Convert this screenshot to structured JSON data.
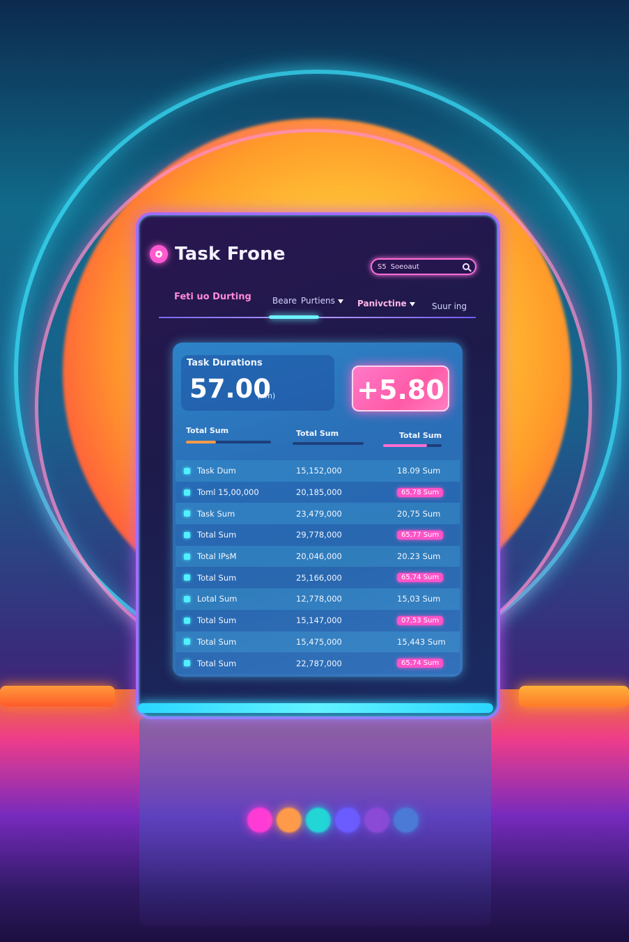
{
  "app": {
    "title": "Task Frone"
  },
  "search": {
    "placeholder": "Soeoaut",
    "lead": "S5"
  },
  "nav": {
    "items": [
      {
        "label": "Feti uo Durting",
        "active": true
      },
      {
        "label": "Beare",
        "active": false
      },
      {
        "label": "Purtiens",
        "active": false,
        "dropdown": true
      },
      {
        "label": "Panivctine",
        "active": false,
        "dropdown": true,
        "bold": true
      },
      {
        "label": "Suur ing",
        "active": false
      }
    ]
  },
  "summary": {
    "label": "Task Durations",
    "value": "57.00",
    "unit": "(nm)",
    "delta": "+5.80"
  },
  "columns": [
    {
      "label": "Total Sum",
      "bar_fill": 0.35,
      "bar_color": "#ff9a4a"
    },
    {
      "label": "Total Sum",
      "bar_fill": 0.0,
      "bar_color": "#5fa0ff"
    },
    {
      "label": "Total Sum",
      "bar_fill": 0.75,
      "bar_color": "#ff6fd0"
    }
  ],
  "rows": [
    {
      "name": "Task Dum",
      "value": "15,152,000",
      "sum": "18.09 Sum",
      "highlight": false
    },
    {
      "name": "Toml 15,00,000",
      "value": "20,185,000",
      "sum": "65,78 Sum",
      "highlight": true
    },
    {
      "name": "Task Sum",
      "value": "23,479,000",
      "sum": "20,75 Sum",
      "highlight": false
    },
    {
      "name": "Total Sum",
      "value": "29,778,000",
      "sum": "65,77 Sum",
      "highlight": true
    },
    {
      "name": "Total IPsM",
      "value": "20,046,000",
      "sum": "20.23 Sum",
      "highlight": false
    },
    {
      "name": "Total Sum",
      "value": "25,166,000",
      "sum": "65,74 Sum",
      "highlight": true
    },
    {
      "name": "Lotal Sum",
      "value": "12,778,000",
      "sum": "15,03 Sum",
      "highlight": false
    },
    {
      "name": "Total Sum",
      "value": "15,147,000",
      "sum": "07,53 Sum",
      "highlight": true
    },
    {
      "name": "Total Sum",
      "value": "15,475,000",
      "sum": "15,443 Sum",
      "highlight": false
    },
    {
      "name": "Total Sum",
      "value": "22,787,000",
      "sum": "65,74 Sum",
      "highlight": true
    }
  ],
  "colors": {
    "accent_pink": "#ff5ad1",
    "accent_cyan": "#4ff0ff",
    "card_blue": "#2a6fb8"
  },
  "icons": {
    "logo": "logo-icon",
    "search": "search-icon",
    "row": "row-icon",
    "caret": "chevron-down-icon"
  },
  "reflection_dots": [
    "#ff3bd6",
    "#ff9a4a",
    "#22d6d6",
    "#6a5cff",
    "#8a4ad6",
    "#4a7ad6"
  ]
}
